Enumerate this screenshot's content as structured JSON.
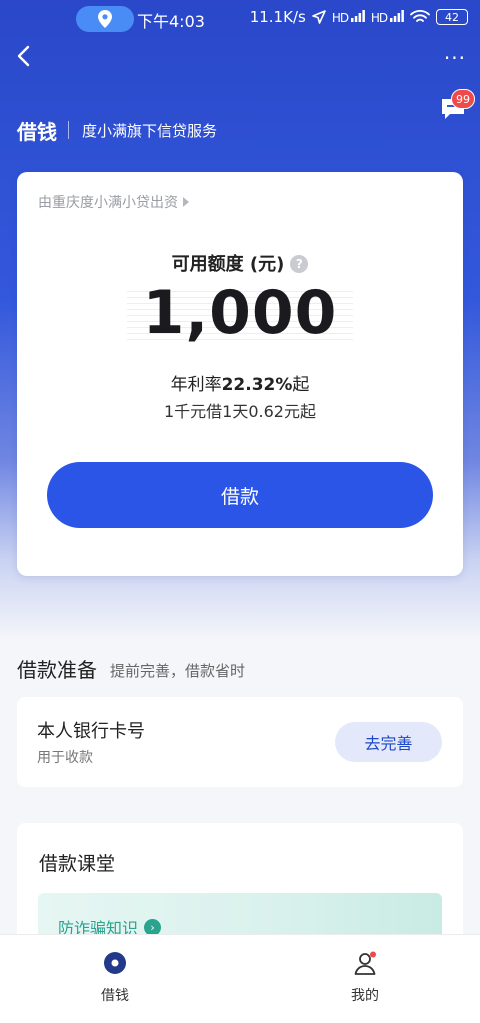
{
  "status_bar": {
    "time": "下午4:03",
    "network_speed": "11.1K/s",
    "signal1_label": "HD",
    "signal2_label": "HD",
    "battery": "42"
  },
  "nav": {
    "more_label": "···"
  },
  "message_badge": "99",
  "header": {
    "title": "借钱",
    "subtitle": "度小满旗下信贷服务"
  },
  "credit_card": {
    "lender": "由重庆度小满小贷出资",
    "credit_label": "可用额度 (元)",
    "amount": "1,000",
    "rate_prefix": "年利率",
    "rate_value": "22.32%",
    "rate_suffix": "起",
    "daily_cost": "1千元借1天0.62元起",
    "borrow_button": "借款"
  },
  "prepare_section": {
    "title": "借款准备",
    "subtitle": "提前完善，借款省时",
    "bank_card": {
      "title": "本人银行卡号",
      "subtitle": "用于收款",
      "action": "去完善"
    }
  },
  "class_section": {
    "title": "借款课堂",
    "banner_label": "防诈骗知识"
  },
  "tabbar": {
    "items": [
      {
        "label": "借钱",
        "icon": "home-circle-icon"
      },
      {
        "label": "我的",
        "icon": "profile-icon"
      }
    ]
  },
  "colors": {
    "primary": "#2a55e6",
    "header_bg": "#2a48c9",
    "badge": "#ef4a4a",
    "teal": "#2aa38f"
  }
}
